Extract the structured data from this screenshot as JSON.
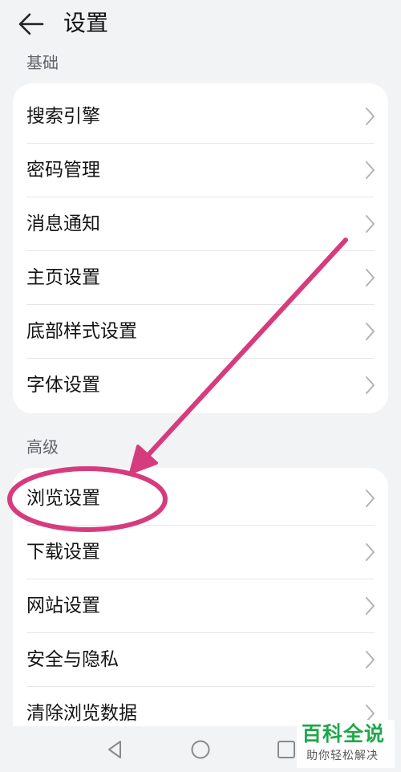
{
  "header": {
    "title": "设置",
    "back_icon": "back-arrow-icon"
  },
  "sections": [
    {
      "title": "基础",
      "items": [
        {
          "label": "搜索引擎"
        },
        {
          "label": "密码管理"
        },
        {
          "label": "消息通知"
        },
        {
          "label": "主页设置"
        },
        {
          "label": "底部样式设置"
        },
        {
          "label": "字体设置"
        }
      ]
    },
    {
      "title": "高级",
      "items": [
        {
          "label": "浏览设置"
        },
        {
          "label": "下载设置"
        },
        {
          "label": "网站设置"
        },
        {
          "label": "安全与隐私"
        },
        {
          "label": "清除浏览数据"
        }
      ]
    }
  ],
  "row_icon": "chevron-right-icon",
  "navbar": {
    "icons": [
      "nav-back-icon",
      "nav-home-icon",
      "nav-recents-icon"
    ]
  },
  "annotation": {
    "color": "#d63c7d"
  },
  "watermark": {
    "title": "百科全说",
    "subtitle": "助你轻松解决",
    "color": "#1ea84a"
  },
  "colors": {
    "background": "#f1f3f5",
    "card": "#ffffff",
    "divider": "#e6e6e6",
    "chevron": "#b3b3b3",
    "section_title": "#5f6368"
  }
}
